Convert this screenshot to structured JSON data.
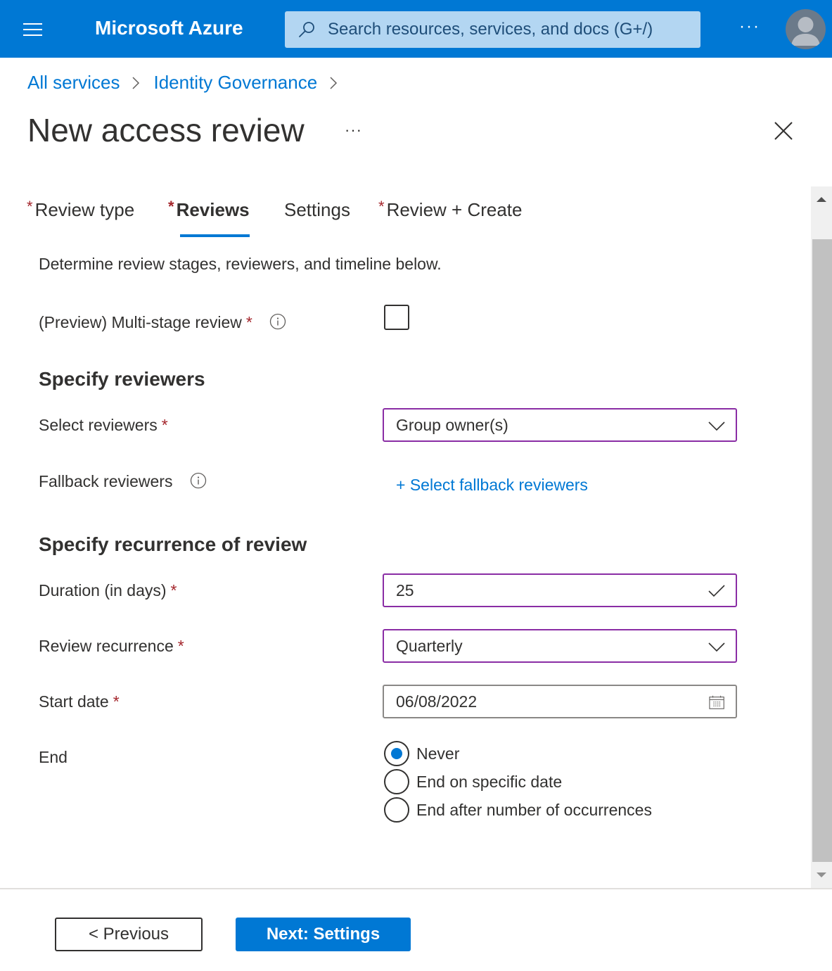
{
  "header": {
    "brand": "Microsoft Azure",
    "search_placeholder": "Search resources, services, and docs (G+/)",
    "more_label": "···",
    "icons": [
      "menu-icon",
      "search-icon",
      "more-icon",
      "avatar-icon"
    ],
    "brand_color": "#0078d4"
  },
  "breadcrumb": [
    {
      "label": "All services"
    },
    {
      "label": "Identity Governance"
    }
  ],
  "page": {
    "title": "New access review",
    "more_label": "···"
  },
  "tabs": [
    {
      "label": "Review type",
      "required": true,
      "active": false
    },
    {
      "label": "Reviews",
      "required": true,
      "active": true
    },
    {
      "label": "Settings",
      "required": false,
      "active": false
    },
    {
      "label": "Review + Create",
      "required": true,
      "active": false
    }
  ],
  "required_marker": "*",
  "form": {
    "description": "Determine review stages, reviewers, and timeline below.",
    "multi_stage": {
      "label": "(Preview) Multi-stage review",
      "checked": false
    },
    "section_reviewers": "Specify reviewers",
    "select_reviewers": {
      "label": "Select reviewers",
      "value": "Group owner(s)"
    },
    "fallback_reviewers": {
      "label": "Fallback reviewers",
      "link": "+ Select fallback reviewers"
    },
    "section_recurrence": "Specify recurrence of review",
    "duration": {
      "label": "Duration (in days)",
      "value": "25"
    },
    "recurrence": {
      "label": "Review recurrence",
      "value": "Quarterly"
    },
    "start_date": {
      "label": "Start date",
      "value": "06/08/2022"
    },
    "end": {
      "label": "End",
      "options": [
        {
          "label": "Never",
          "checked": true
        },
        {
          "label": "End on specific date",
          "checked": false
        },
        {
          "label": "End after number of occurrences",
          "checked": false
        }
      ]
    }
  },
  "footer": {
    "previous_label": "< Previous",
    "next_label": "Next: Settings"
  },
  "colors": {
    "accent": "#0078d4",
    "required": "#a4262c",
    "focus_border": "#8a2da5"
  }
}
